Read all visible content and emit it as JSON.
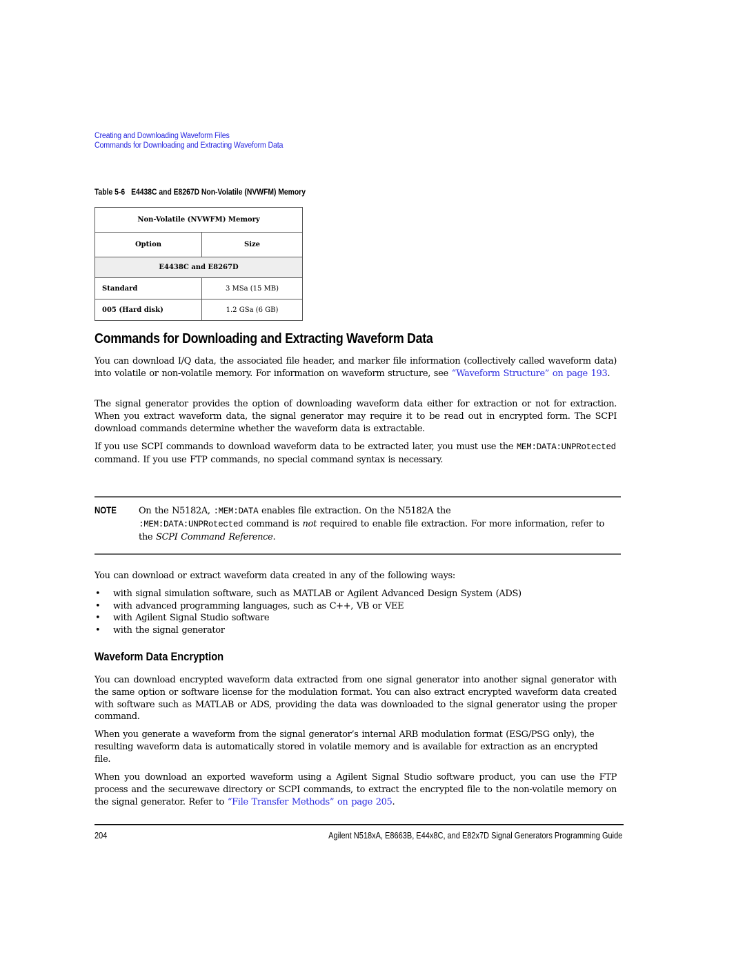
{
  "breadcrumb": {
    "items": [
      "Creating and Downloading Waveform Files",
      "Commands for Downloading and Extracting Waveform Data"
    ]
  },
  "table": {
    "caption_number": "Table 5-6",
    "caption_title": "E4438C and E8267D Non-Volatile (NVWFM) Memory",
    "title_row": "Non-Volatile (NVWFM) Memory",
    "headers": [
      "Option",
      "Size"
    ],
    "group_label": "E4438C and E8267D",
    "rows": [
      {
        "option": "Standard",
        "size": "3 MSa (15 MB)"
      },
      {
        "option": "005 (Hard disk)",
        "size": "1.2 GSa (6 GB)"
      }
    ]
  },
  "section": {
    "heading": "Commands for Downloading and Extracting Waveform Data",
    "p1_text": "You can download I/Q data, the associated file header, and marker file information (collectively called waveform data) into volatile or non-volatile memory. For information on waveform structure, see ",
    "p1_link": "“Waveform Structure” on page 193",
    "p1_end": ".",
    "p2": "The signal generator provides the option of downloading waveform data either for extraction or not for extraction. When you extract waveform data, the signal generator may require it to be read out in encrypted form. The SCPI download commands determine whether the waveform data is extractable.",
    "p3_start": "If you use SCPI commands to download waveform data to be extracted later, you must use the ",
    "p3_code": "MEM:DATA:UNPRotected",
    "p3_end": " command. If you use FTP commands, no special command syntax is necessary."
  },
  "note": {
    "label": "NOTE",
    "t1": "On the N5182A, ",
    "code1": ":MEM:DATA",
    "t2": " enables file extraction. On the N5182A the ",
    "code2": ":MEM:DATA:UNPRotected",
    "t3": " command is ",
    "em1": "not",
    "t4": " required to enable file extraction. For more information, refer to the ",
    "em2": "SCPI Command Reference",
    "t5": "."
  },
  "ways": {
    "intro": "You can download or extract waveform data created in any of the following ways:",
    "bullet_glyph": "•",
    "items": [
      "with signal simulation software, such as MATLAB or Agilent Advanced Design System (ADS)",
      "with advanced programming languages, such as C++, VB or VEE",
      "with Agilent Signal Studio software",
      "with the signal generator"
    ]
  },
  "encryption": {
    "heading": "Waveform Data Encryption",
    "p1": "You can download encrypted waveform data extracted from one signal generator into another signal generator with the same option or software license for the modulation format. You can also extract encrypted waveform data created with software such as MATLAB or ADS, providing the data was downloaded to the signal generator using the proper command.",
    "p2": "When you generate a waveform from the signal generator’s internal ARB modulation format (ESG/PSG only), the resulting waveform data is automatically stored in volatile memory and is available for extraction as an encrypted file.",
    "p3_text": "When you download an exported waveform using a Agilent Signal Studio software product, you can use the FTP process and the securewave directory or SCPI commands, to extract the encrypted file to the non-volatile memory on the signal generator. Refer to ",
    "p3_link": "“File Transfer Methods” on page 205",
    "p3_end": "."
  },
  "footer": {
    "page_number": "204",
    "guide_title": "Agilent N518xA, E8663B, E44x8C, and E82x7D Signal Generators Programming Guide"
  },
  "colors": {
    "link": "#2a2ae0",
    "table_group_bg": "#eeeeee",
    "text": "#000000"
  }
}
